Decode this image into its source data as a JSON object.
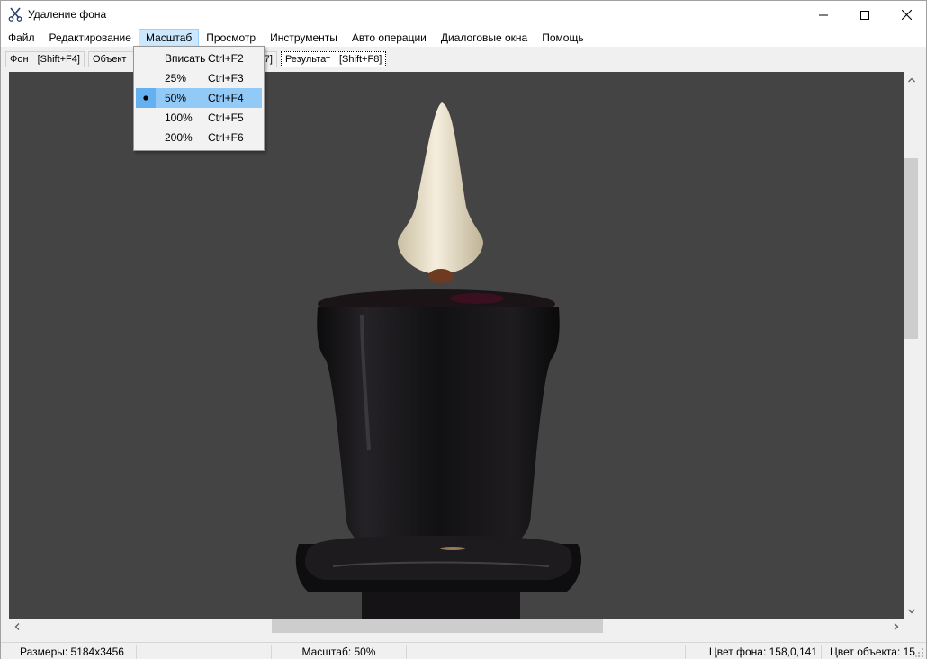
{
  "window": {
    "title": "Удаление фона",
    "minimize_icon": "minimize-icon",
    "maximize_icon": "maximize-icon",
    "close_icon": "close-icon"
  },
  "menu": {
    "items": [
      {
        "label": "Файл"
      },
      {
        "label": "Редактирование"
      },
      {
        "label": "Масштаб",
        "active": true
      },
      {
        "label": "Просмотр"
      },
      {
        "label": "Инструменты"
      },
      {
        "label": "Авто операции"
      },
      {
        "label": "Диалоговые окна"
      },
      {
        "label": "Помощь"
      }
    ]
  },
  "tabs": {
    "items": [
      {
        "label": "Фон",
        "shortcut": "[Shift+F4]"
      },
      {
        "label": "Объект",
        "shortcut": ""
      },
      {
        "label": "",
        "shortcut": "+F7]"
      },
      {
        "label": "Результат",
        "shortcut": "[Shift+F8]",
        "selected": true
      }
    ]
  },
  "zoom_menu": {
    "items": [
      {
        "label": "Вписать",
        "shortcut": "Ctrl+F2",
        "checked": false
      },
      {
        "label": "25%",
        "shortcut": "Ctrl+F3",
        "checked": false
      },
      {
        "label": "50%",
        "shortcut": "Ctrl+F4",
        "checked": true
      },
      {
        "label": "100%",
        "shortcut": "Ctrl+F5",
        "checked": false
      },
      {
        "label": "200%",
        "shortcut": "Ctrl+F6",
        "checked": false
      }
    ]
  },
  "status": {
    "size": "Размеры: 5184x3456",
    "zoom": "Масштаб: 50%",
    "bg_color": "Цвет фона: 158,0,141",
    "obj_color": "Цвет объекта: 15"
  },
  "colors": {
    "canvas_bg": "#444444",
    "menu_highlight": "#91c9f7"
  }
}
